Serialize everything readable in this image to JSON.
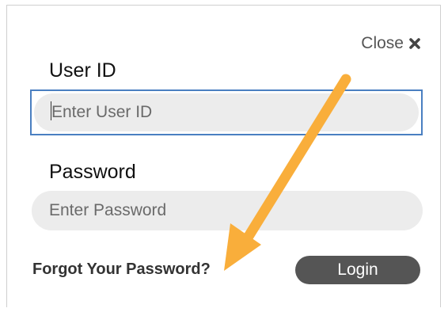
{
  "dialog": {
    "close_label": "Close",
    "close_icon": "close-x-icon"
  },
  "form": {
    "user_id_label": "User ID",
    "user_id_placeholder": "Enter User ID",
    "user_id_value": "",
    "password_label": "Password",
    "password_placeholder": "Enter Password",
    "password_value": "",
    "forgot_link": "Forgot Your Password?",
    "login_button": "Login"
  },
  "annotation": {
    "arrow_color": "#F9AE3B",
    "arrow_icon": "annotation-arrow"
  },
  "colors": {
    "focus_border": "#4A7FC1",
    "input_bg": "#ECECEC",
    "button_bg": "#555555"
  }
}
